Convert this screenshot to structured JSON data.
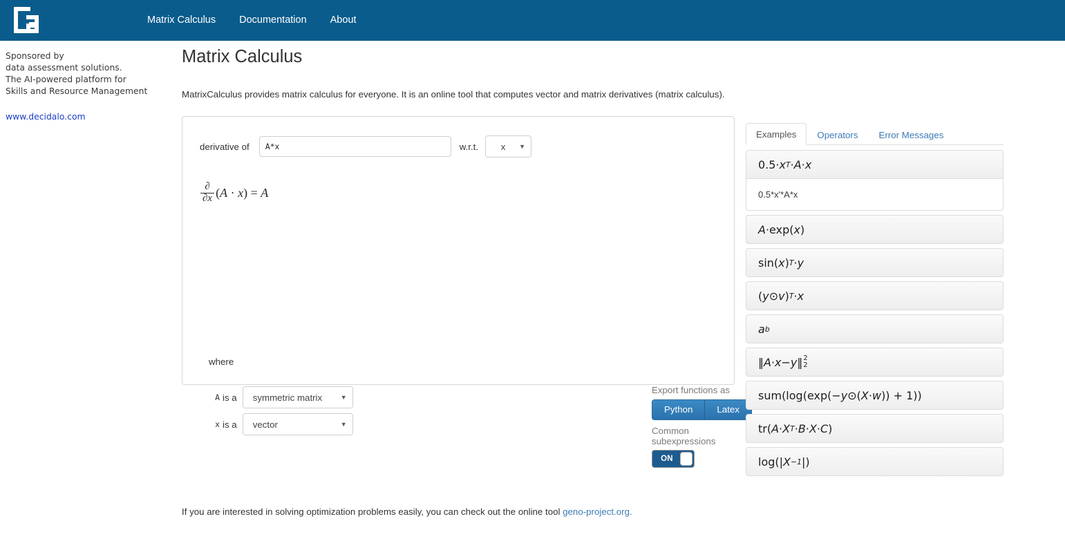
{
  "header": {
    "logo_alt": "geno-logo",
    "nav": [
      {
        "label": "Matrix Calculus"
      },
      {
        "label": "Documentation"
      },
      {
        "label": "About"
      }
    ]
  },
  "sidebar": {
    "sponsor_lines": [
      "Sponsored by",
      "data assessment solutions.",
      "The AI-powered platform for",
      "Skills and Resource Management"
    ],
    "link": "www.decidalo.com"
  },
  "main": {
    "title": "Matrix Calculus",
    "intro": "MatrixCalculus provides matrix calculus for everyone. It is an online tool that computes vector and matrix derivatives (matrix calculus).",
    "footer_text": "If you are interested in solving optimization problems easily, you can check out the online tool ",
    "footer_link": "geno-project.org."
  },
  "calculator": {
    "derivative_label": "derivative of",
    "expression_value": "A*x",
    "expression_placeholder": "",
    "wrt_label": "w.r.t.",
    "wrt_value": "x",
    "where_label": "where",
    "where_rows": [
      {
        "var": "A",
        "isa": "is a",
        "type": "symmetric matrix"
      },
      {
        "var": "x",
        "isa": "is a",
        "type": "vector"
      }
    ],
    "result": {
      "numerator": "∂",
      "denominator": "∂x",
      "body_open": "(",
      "body_a": "A",
      "body_dot": " · ",
      "body_x": "x",
      "body_close": ")",
      "equals": " = ",
      "rhs": "A"
    },
    "export_label": "Export functions as",
    "export_python": "Python",
    "export_latex": "Latex",
    "cse_label": "Common subexpressions",
    "cse_state": "ON"
  },
  "side_panel": {
    "tabs": [
      {
        "label": "Examples",
        "active": true
      },
      {
        "label": "Operators",
        "active": false
      },
      {
        "label": "Error Messages",
        "active": false
      }
    ],
    "selected_expansion": "0.5*x'*A*x",
    "examples": [
      {
        "id": "ex1",
        "parts": [
          {
            "t": "0.5",
            "s": "plain"
          },
          {
            "t": " · ",
            "s": "op"
          },
          {
            "t": "x",
            "s": "mi"
          },
          {
            "t": "T",
            "s": "sup"
          },
          {
            "t": " · ",
            "s": "op"
          },
          {
            "t": "A",
            "s": "mi"
          },
          {
            "t": " · ",
            "s": "op"
          },
          {
            "t": "x",
            "s": "mi"
          }
        ]
      },
      {
        "id": "ex2",
        "parts": [
          {
            "t": "A",
            "s": "mi"
          },
          {
            "t": " · ",
            "s": "op"
          },
          {
            "t": "exp(",
            "s": "plain"
          },
          {
            "t": "x",
            "s": "mi"
          },
          {
            "t": ")",
            "s": "plain"
          }
        ]
      },
      {
        "id": "ex3",
        "parts": [
          {
            "t": "sin(",
            "s": "plain"
          },
          {
            "t": "x",
            "s": "mi"
          },
          {
            "t": ")",
            "s": "plain"
          },
          {
            "t": "T",
            "s": "sup"
          },
          {
            "t": " · ",
            "s": "op"
          },
          {
            "t": "y",
            "s": "mi"
          }
        ]
      },
      {
        "id": "ex4",
        "parts": [
          {
            "t": "(",
            "s": "plain"
          },
          {
            "t": "y",
            "s": "mi"
          },
          {
            "t": " ⊙ ",
            "s": "op"
          },
          {
            "t": "v",
            "s": "mi"
          },
          {
            "t": ")",
            "s": "plain"
          },
          {
            "t": "T",
            "s": "sup"
          },
          {
            "t": " · ",
            "s": "op"
          },
          {
            "t": "x",
            "s": "mi"
          }
        ]
      },
      {
        "id": "ex5",
        "parts": [
          {
            "t": "a",
            "s": "mi"
          },
          {
            "t": "b",
            "s": "sup"
          }
        ]
      },
      {
        "id": "ex6",
        "parts": [
          {
            "t": "‖",
            "s": "plain"
          },
          {
            "t": "A",
            "s": "mi"
          },
          {
            "t": " · ",
            "s": "op"
          },
          {
            "t": "x",
            "s": "mi"
          },
          {
            "t": " − ",
            "s": "op"
          },
          {
            "t": "y",
            "s": "mi"
          },
          {
            "t": "‖",
            "s": "plain"
          },
          {
            "t": "2|2",
            "s": "subsup"
          }
        ]
      },
      {
        "id": "ex7",
        "parts": [
          {
            "t": "sum(log(exp(−",
            "s": "plain"
          },
          {
            "t": "y",
            "s": "mi"
          },
          {
            "t": " ⊙ ",
            "s": "op"
          },
          {
            "t": "(",
            "s": "plain"
          },
          {
            "t": "X",
            "s": "mi"
          },
          {
            "t": " · ",
            "s": "op"
          },
          {
            "t": "w",
            "s": "mi"
          },
          {
            "t": ")) + 1))",
            "s": "plain"
          }
        ]
      },
      {
        "id": "ex8",
        "parts": [
          {
            "t": "tr(",
            "s": "plain"
          },
          {
            "t": "A",
            "s": "mi"
          },
          {
            "t": " · ",
            "s": "op"
          },
          {
            "t": "X",
            "s": "mi"
          },
          {
            "t": "T",
            "s": "sup"
          },
          {
            "t": " · ",
            "s": "op"
          },
          {
            "t": "B",
            "s": "mi"
          },
          {
            "t": " · ",
            "s": "op"
          },
          {
            "t": "X",
            "s": "mi"
          },
          {
            "t": " · ",
            "s": "op"
          },
          {
            "t": "C",
            "s": "mi"
          },
          {
            "t": ")",
            "s": "plain"
          }
        ]
      },
      {
        "id": "ex9",
        "parts": [
          {
            "t": "log(|",
            "s": "plain"
          },
          {
            "t": "X",
            "s": "mi"
          },
          {
            "t": "−1",
            "s": "sup"
          },
          {
            "t": "|)",
            "s": "plain"
          }
        ]
      }
    ]
  },
  "colors": {
    "header_blue": "#0a5c8c",
    "link_blue": "#3b7bb5",
    "button_blue": "#2b72ad",
    "toggle_blue": "#1d5b8e",
    "sponsor_link": "#1a3fc4"
  }
}
